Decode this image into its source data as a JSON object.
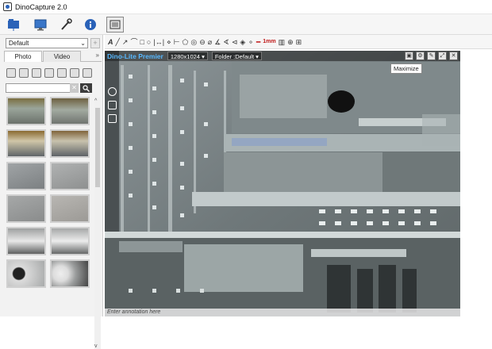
{
  "window": {
    "title": "DinoCapture 2.0"
  },
  "toolbar": {
    "icons": [
      "snapshot-folder-icon",
      "display-icon",
      "tools-icon",
      "info-icon",
      "capture-window-icon"
    ]
  },
  "left": {
    "profile": "Default",
    "tabs": [
      "Photo",
      "Video"
    ],
    "search_placeholder": ""
  },
  "drawing_toolbar": {
    "glyphs": [
      "A",
      "╱",
      "↗",
      "⌒",
      "□",
      "○",
      "|↔|",
      "⋄",
      "⊢",
      "⬠",
      "◎",
      "⊖",
      "⌀",
      "∡",
      "∢",
      "⊲",
      "◈",
      "⚬",
      "━",
      "1mm",
      "▥",
      "⊕",
      "⊞"
    ]
  },
  "viewer": {
    "brand": "Dino-Lite Premier",
    "resolution": "1280x1024",
    "folder": "Folder :Default",
    "tooltip": "Maximize",
    "annotation_placeholder": "Enter annotation here"
  },
  "colors": {
    "accent": "#2a62b8",
    "brand": "#58b8ff",
    "red": "#c01818"
  }
}
